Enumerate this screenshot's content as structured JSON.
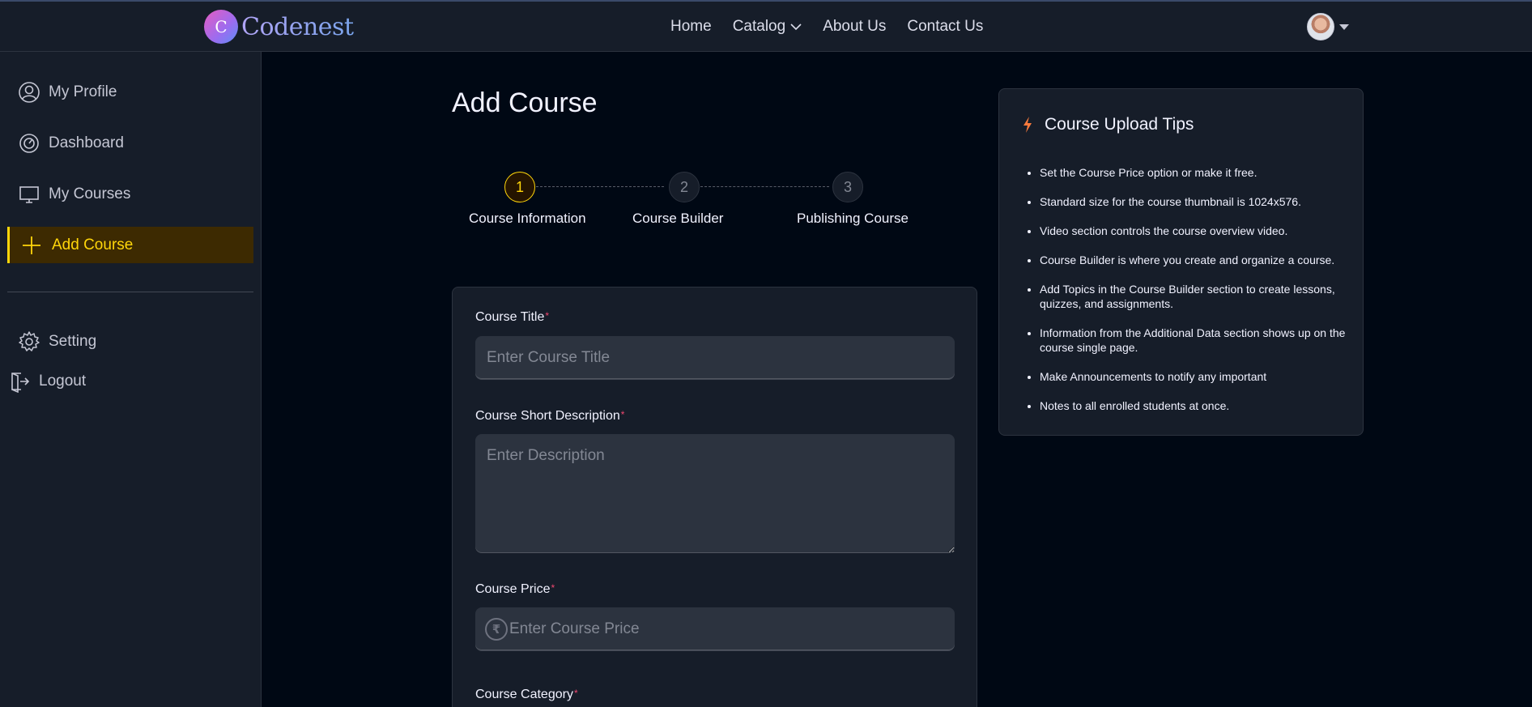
{
  "brand": {
    "badge_letter": "C",
    "name": "Codenest"
  },
  "nav": {
    "items": [
      "Home",
      "Catalog",
      "About Us",
      "Contact Us"
    ]
  },
  "sidebar": {
    "items": [
      {
        "label": "My Profile",
        "icon": "user-circle-icon"
      },
      {
        "label": "Dashboard",
        "icon": "gauge-icon"
      },
      {
        "label": "My Courses",
        "icon": "monitor-icon"
      },
      {
        "label": "Add Course",
        "icon": "plus-icon",
        "active": true
      },
      {
        "label": "Setting",
        "icon": "gear-icon"
      },
      {
        "label": "Logout",
        "icon": "logout-icon"
      }
    ]
  },
  "main": {
    "title": "Add Course",
    "steps": [
      {
        "number": "1",
        "label": "Course Information",
        "status": "active"
      },
      {
        "number": "2",
        "label": "Course Builder",
        "status": "idle"
      },
      {
        "number": "3",
        "label": "Publishing Course",
        "status": "idle"
      }
    ],
    "form": {
      "title_label": "Course Title",
      "title_placeholder": "Enter Course Title",
      "desc_label": "Course Short Description",
      "desc_placeholder": "Enter Description",
      "price_label": "Course Price",
      "price_placeholder": "Enter Course Price",
      "price_currency_symbol": "₹",
      "category_label": "Course Category",
      "required_mark": "*"
    }
  },
  "tips": {
    "title": "Course Upload Tips",
    "items": [
      "Set the Course Price option or make it free.",
      "Standard size for the course thumbnail is 1024x576.",
      "Video section controls the course overview video.",
      "Course Builder is where you create and organize a course.",
      "Add Topics in the Course Builder section to create lessons, quizzes, and assignments.",
      "Information from the Additional Data section shows up on the course single page.",
      "Make Announcements to notify any important",
      "Notes to all enrolled students at once."
    ]
  },
  "colors": {
    "accent": "#ffd60a",
    "required": "#ef476f",
    "tip_icon": "#f97a3d",
    "background": "#000814",
    "panel": "#161d29"
  }
}
